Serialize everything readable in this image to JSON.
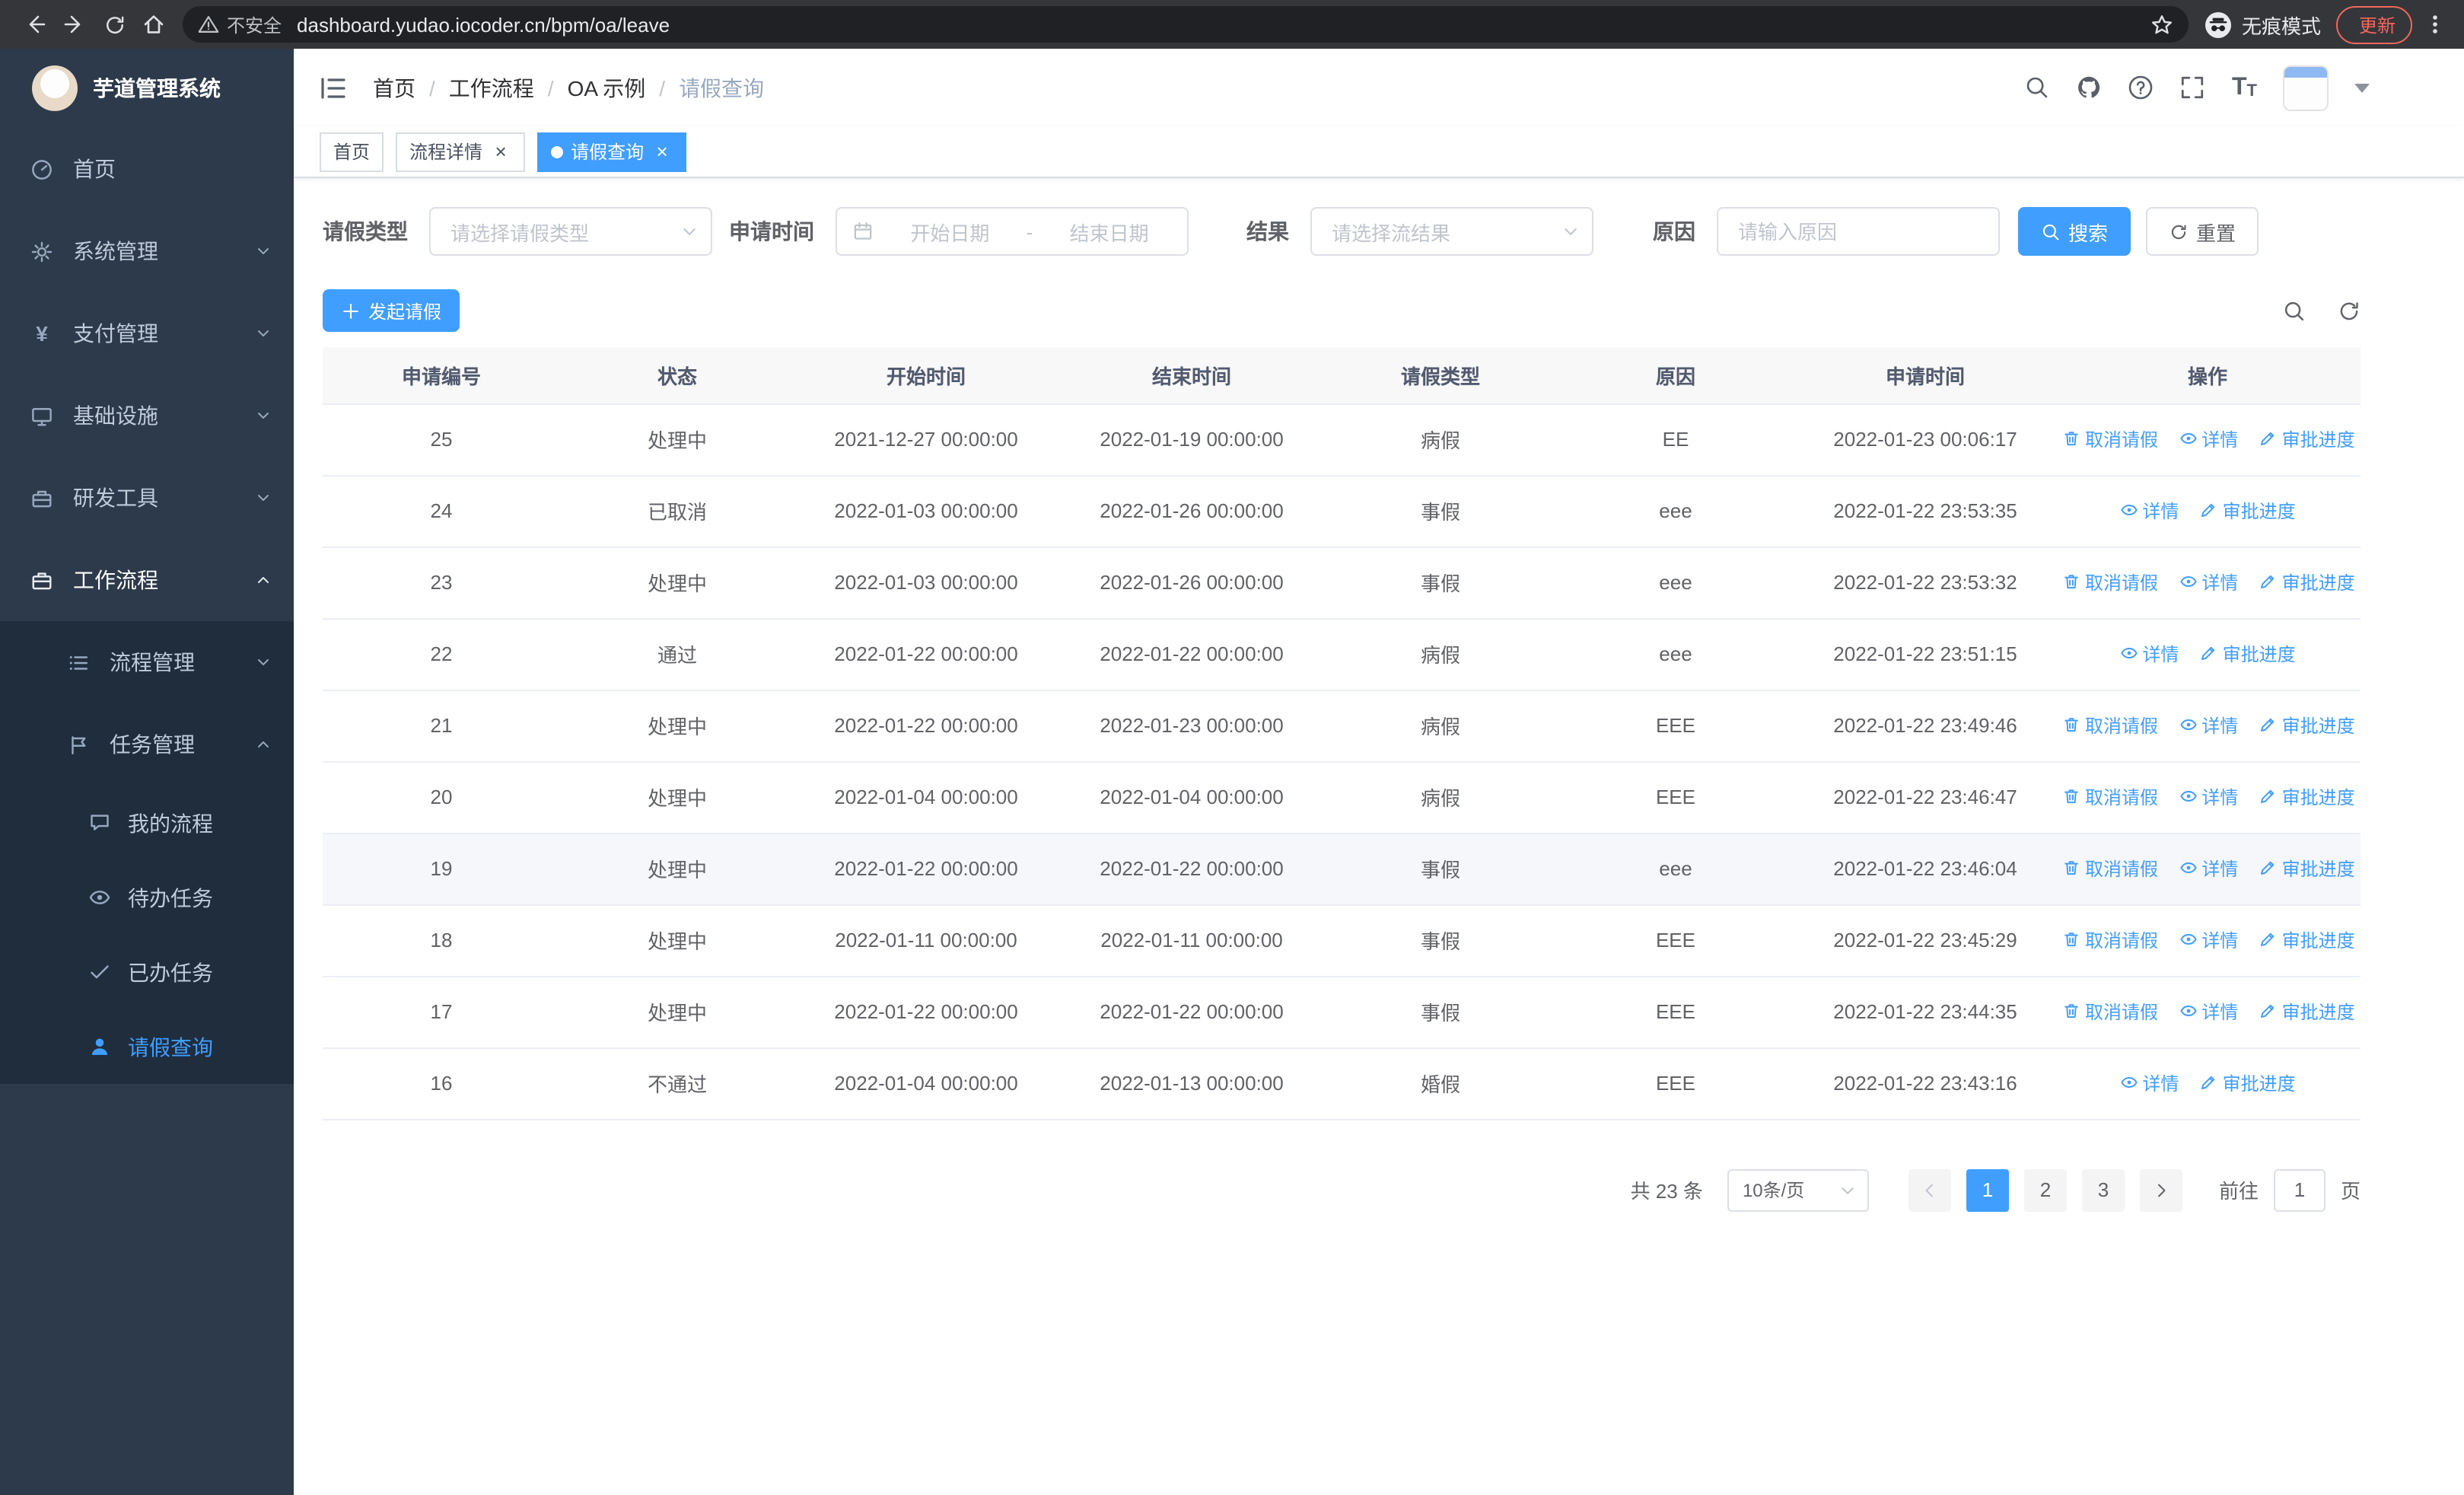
{
  "browser": {
    "security_label": "不安全",
    "url": "dashboard.yudao.iocoder.cn/bpm/oa/leave",
    "incognito_label": "无痕模式",
    "update_label": "更新"
  },
  "app": {
    "title": "芋道管理系统"
  },
  "sidebar": {
    "items": [
      {
        "label": "首页"
      },
      {
        "label": "系统管理"
      },
      {
        "label": "支付管理"
      },
      {
        "label": "基础设施"
      },
      {
        "label": "研发工具"
      },
      {
        "label": "工作流程"
      }
    ],
    "groups": [
      {
        "label": "流程管理"
      },
      {
        "label": "任务管理"
      }
    ],
    "leaves": [
      {
        "label": "我的流程"
      },
      {
        "label": "待办任务"
      },
      {
        "label": "已办任务"
      },
      {
        "label": "请假查询"
      }
    ]
  },
  "breadcrumb": [
    "首页",
    "工作流程",
    "OA 示例",
    "请假查询"
  ],
  "breadcrumb_sep": "/",
  "tabs": [
    {
      "label": "首页"
    },
    {
      "label": "流程详情"
    },
    {
      "label": "请假查询"
    }
  ],
  "filters": {
    "leave_type": {
      "label": "请假类型",
      "placeholder": "请选择请假类型"
    },
    "apply_time": {
      "label": "申请时间",
      "start_placeholder": "开始日期",
      "separator": "-",
      "end_placeholder": "结束日期"
    },
    "result": {
      "label": "结果",
      "placeholder": "请选择流结果"
    },
    "reason": {
      "label": "原因",
      "placeholder": "请输入原因"
    },
    "search_label": "搜索",
    "reset_label": "重置"
  },
  "toolbar": {
    "create_label": "发起请假"
  },
  "table": {
    "columns": [
      "申请编号",
      "状态",
      "开始时间",
      "结束时间",
      "请假类型",
      "原因",
      "申请时间",
      "操作"
    ],
    "ops": {
      "cancel": "取消请假",
      "detail": "详情",
      "progress": "审批进度"
    },
    "rows": [
      {
        "id": "25",
        "status": "处理中",
        "start": "2021-12-27 00:00:00",
        "end": "2022-01-19 00:00:00",
        "type": "病假",
        "reason": "EE",
        "apply_time": "2022-01-23 00:06:17",
        "can_cancel": true,
        "highlight": false
      },
      {
        "id": "24",
        "status": "已取消",
        "start": "2022-01-03 00:00:00",
        "end": "2022-01-26 00:00:00",
        "type": "事假",
        "reason": "eee",
        "apply_time": "2022-01-22 23:53:35",
        "can_cancel": false,
        "highlight": false
      },
      {
        "id": "23",
        "status": "处理中",
        "start": "2022-01-03 00:00:00",
        "end": "2022-01-26 00:00:00",
        "type": "事假",
        "reason": "eee",
        "apply_time": "2022-01-22 23:53:32",
        "can_cancel": true,
        "highlight": false
      },
      {
        "id": "22",
        "status": "通过",
        "start": "2022-01-22 00:00:00",
        "end": "2022-01-22 00:00:00",
        "type": "病假",
        "reason": "eee",
        "apply_time": "2022-01-22 23:51:15",
        "can_cancel": false,
        "highlight": false
      },
      {
        "id": "21",
        "status": "处理中",
        "start": "2022-01-22 00:00:00",
        "end": "2022-01-23 00:00:00",
        "type": "病假",
        "reason": "EEE",
        "apply_time": "2022-01-22 23:49:46",
        "can_cancel": true,
        "highlight": false
      },
      {
        "id": "20",
        "status": "处理中",
        "start": "2022-01-04 00:00:00",
        "end": "2022-01-04 00:00:00",
        "type": "病假",
        "reason": "EEE",
        "apply_time": "2022-01-22 23:46:47",
        "can_cancel": true,
        "highlight": false
      },
      {
        "id": "19",
        "status": "处理中",
        "start": "2022-01-22 00:00:00",
        "end": "2022-01-22 00:00:00",
        "type": "事假",
        "reason": "eee",
        "apply_time": "2022-01-22 23:46:04",
        "can_cancel": true,
        "highlight": true
      },
      {
        "id": "18",
        "status": "处理中",
        "start": "2022-01-11 00:00:00",
        "end": "2022-01-11 00:00:00",
        "type": "事假",
        "reason": "EEE",
        "apply_time": "2022-01-22 23:45:29",
        "can_cancel": true,
        "highlight": false
      },
      {
        "id": "17",
        "status": "处理中",
        "start": "2022-01-22 00:00:00",
        "end": "2022-01-22 00:00:00",
        "type": "事假",
        "reason": "EEE",
        "apply_time": "2022-01-22 23:44:35",
        "can_cancel": true,
        "highlight": false
      },
      {
        "id": "16",
        "status": "不通过",
        "start": "2022-01-04 00:00:00",
        "end": "2022-01-13 00:00:00",
        "type": "婚假",
        "reason": "EEE",
        "apply_time": "2022-01-22 23:43:16",
        "can_cancel": false,
        "highlight": false
      }
    ]
  },
  "pagination": {
    "total_label": "共 23 条",
    "page_size": "10条/页",
    "pages": [
      "1",
      "2",
      "3"
    ],
    "goto_label": "前往",
    "goto_value": "1",
    "unit_label": "页"
  }
}
